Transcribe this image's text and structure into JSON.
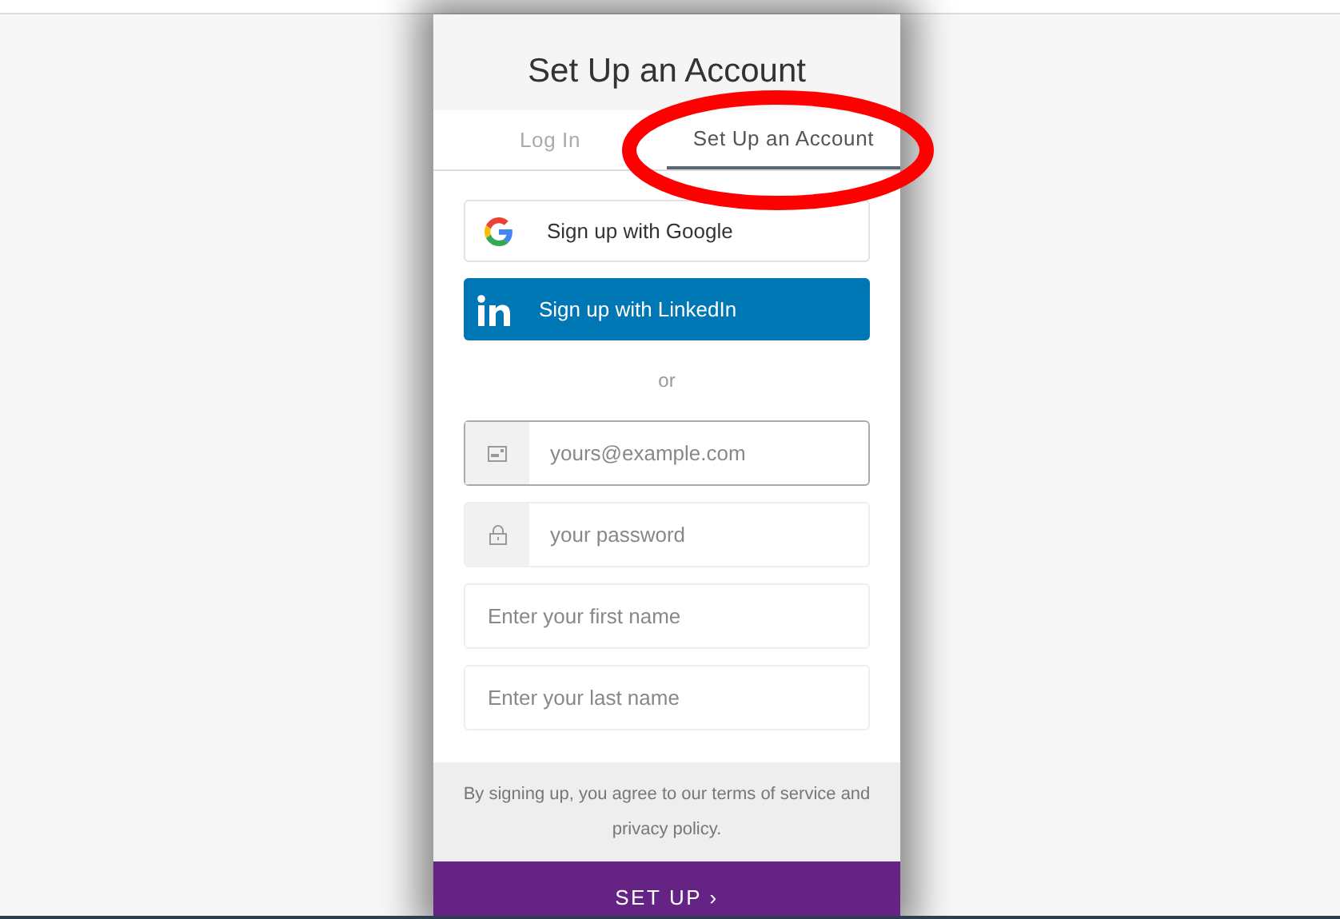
{
  "title": "Set Up an Account",
  "tabs": [
    {
      "label": "Log In",
      "selected": false
    },
    {
      "label": "Set Up an Account",
      "selected": true
    }
  ],
  "social_buttons": [
    {
      "kind": "google",
      "label": "Sign up with Google"
    },
    {
      "kind": "linkedin",
      "label": "Sign up with LinkedIn"
    }
  ],
  "separator": "or",
  "fields": [
    {
      "kind": "email",
      "placeholder": "yours@example.com",
      "focused": true
    },
    {
      "kind": "password",
      "placeholder": "your password",
      "focused": false
    },
    {
      "kind": "plain",
      "placeholder": "Enter your first name",
      "focused": false
    },
    {
      "kind": "plain",
      "placeholder": "Enter your last name",
      "focused": false
    }
  ],
  "terms": "By signing up, you agree to our terms of service and privacy policy.",
  "submit": "SET UP ›",
  "annotation": {
    "kind": "ellipse"
  }
}
